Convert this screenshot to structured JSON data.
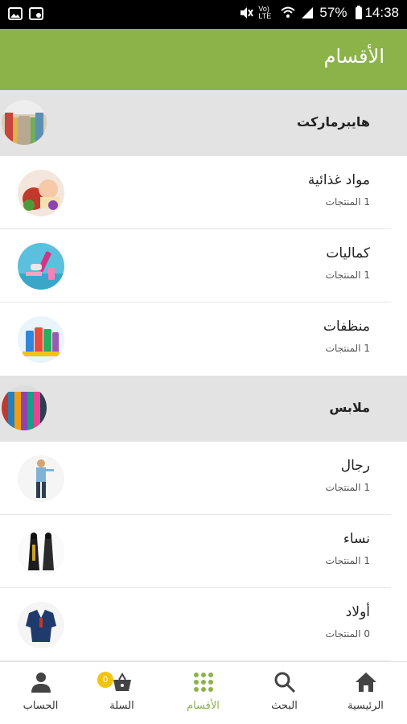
{
  "status_bar": {
    "battery": "57%",
    "time": "14:38",
    "network": "Vo) LTE",
    "icons": [
      "image-icon",
      "cast-icon",
      "mute-icon",
      "wifi-icon",
      "signal-icon",
      "battery-icon"
    ]
  },
  "header": {
    "title": "الأقسام"
  },
  "colors": {
    "accent": "#8bb34a",
    "section_bg": "#e3e3e3",
    "badge": "#f1c40f"
  },
  "sections": [
    {
      "title": "هايبرماركت",
      "image": "hypermarket-thumbnail",
      "items": [
        {
          "title": "مواد غذائية",
          "subtitle": "1 المنتجات",
          "image": "food-thumbnail"
        },
        {
          "title": "كماليات",
          "subtitle": "1 المنتجات",
          "image": "accessories-thumbnail"
        },
        {
          "title": "منظفات",
          "subtitle": "1 المنتجات",
          "image": "detergents-thumbnail"
        }
      ]
    },
    {
      "title": "ملابس",
      "image": "clothes-thumbnail",
      "items": [
        {
          "title": "رجال",
          "subtitle": "1 المنتجات",
          "image": "men-thumbnail"
        },
        {
          "title": "نساء",
          "subtitle": "1 المنتجات",
          "image": "women-thumbnail"
        },
        {
          "title": "أولاد",
          "subtitle": "0 المنتجات",
          "image": "kids-thumbnail"
        }
      ]
    }
  ],
  "bottom_nav": {
    "items": [
      {
        "label": "الحساب",
        "icon": "person-icon"
      },
      {
        "label": "السلة",
        "icon": "basket-icon",
        "badge": "0"
      },
      {
        "label": "الأقسام",
        "icon": "grid-icon",
        "active": true
      },
      {
        "label": "البحث",
        "icon": "search-icon"
      },
      {
        "label": "الرئيسية",
        "icon": "home-icon"
      }
    ]
  }
}
